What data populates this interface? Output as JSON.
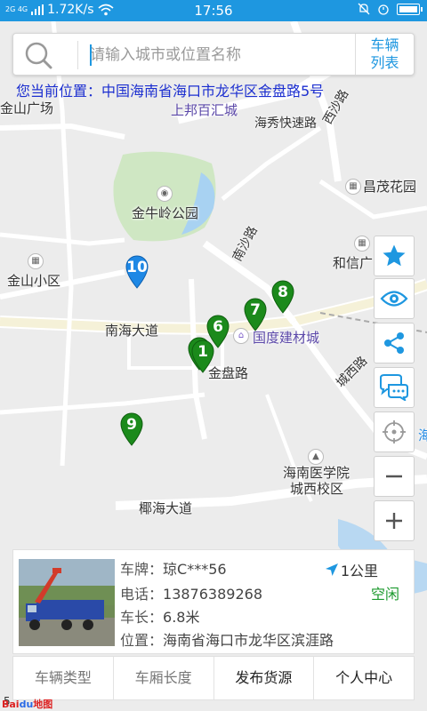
{
  "status_bar": {
    "network": "2G 4G",
    "speed": "1.72K/s",
    "time": "17:56"
  },
  "search": {
    "placeholder": "请输入城市或位置名称",
    "vehicle_list_label": "车辆列表"
  },
  "current_location": "您当前位置：中国海南省海口市龙华区金盘路5号",
  "map": {
    "labels": {
      "jinshan_square": "金山广场",
      "shangbang": "上邦百汇城",
      "haixiu": "海秀快速路",
      "xisha": "西沙路",
      "changmao": "昌茂花园",
      "jinniuling": "金牛岭公园",
      "nansha": "南沙路",
      "hexin": "和信广",
      "jinshan_district": "金山小区",
      "nanhai_avenue": "南海大道",
      "guodu": "国度建材城",
      "jinpan": "金盘路",
      "chengxi": "城西路",
      "med_school_1": "海南医学院",
      "med_school_2": "城西校区",
      "liuhai": "椰海大道",
      "hai_edge": "海"
    },
    "markers": [
      {
        "num": "10",
        "color": "#1e88e5"
      },
      {
        "num": "8",
        "color": "#1b8a1b"
      },
      {
        "num": "7",
        "color": "#1b8a1b"
      },
      {
        "num": "6",
        "color": "#1b8a1b"
      },
      {
        "num": "1",
        "color": "#1b8a1b"
      },
      {
        "num": "9",
        "color": "#1b8a1b"
      }
    ],
    "scale": "5"
  },
  "tools": [
    "star-icon",
    "eye-icon",
    "share-icon",
    "chat-icon",
    "locate-icon",
    "zoom-out-icon",
    "zoom-in-icon"
  ],
  "vehicle": {
    "plate_label": "车牌：",
    "plate": "琼C***56",
    "phone_label": "电话：",
    "phone": "13876389268",
    "length_label": "车长：",
    "length": "6.8米",
    "location_label": "位置：",
    "location": "海南省海口市龙华区滨涯路",
    "distance": "1公里",
    "status": "空闲"
  },
  "tabs": [
    {
      "label": "车辆类型"
    },
    {
      "label": "车厢长度"
    },
    {
      "label": "发布货源"
    },
    {
      "label": "个人中心"
    }
  ],
  "baidu": {
    "bai": "Bai",
    "du": "du",
    "map": "地图"
  },
  "colors": {
    "accent": "#1e97e0",
    "marker_green": "#1b8a1b",
    "marker_blue": "#1e88e5",
    "status_green": "#1c9a2e",
    "location_text": "#1c2fd0"
  }
}
